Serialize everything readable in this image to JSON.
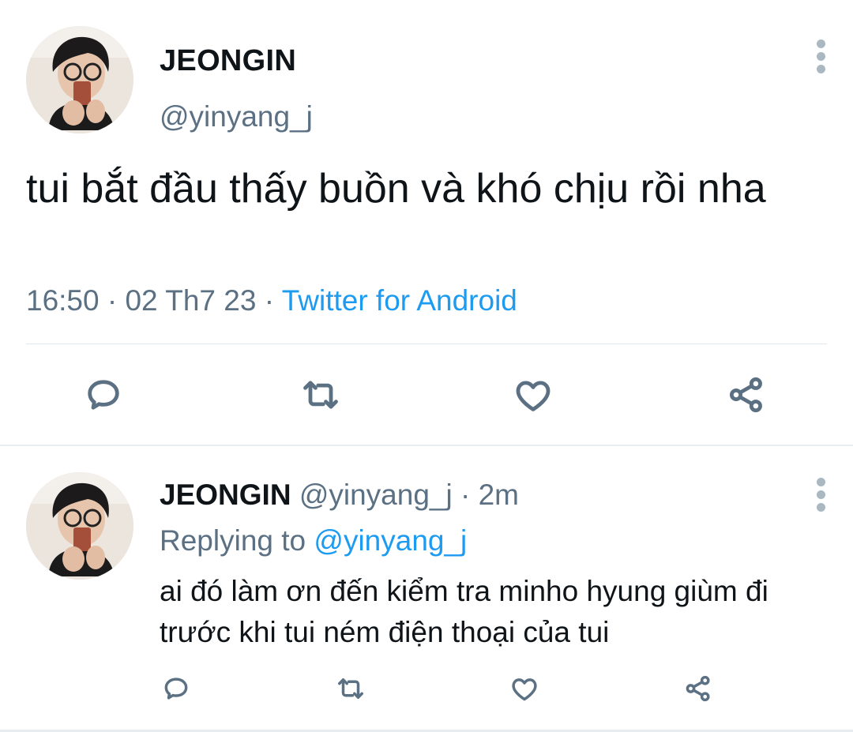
{
  "main_tweet": {
    "name": "JEONGIN",
    "handle": "@yinyang_j",
    "text": "tui bắt đầu thấy buồn và khó chịu rồi nha",
    "time": "16:50",
    "date": "02 Th7 23",
    "source": "Twitter for Android",
    "separator": "·",
    "actions": [
      "reply-icon",
      "retweet-icon",
      "like-icon",
      "share-icon"
    ]
  },
  "reply_tweet": {
    "name": "JEONGIN",
    "handle": "@yinyang_j",
    "dot": "·",
    "time": "2m",
    "replying_label": "Replying to",
    "replying_to": "@yinyang_j",
    "text": "ai đó làm ơn đến kiểm tra minho hyung giùm đi trước khi tui ném điện thoại của tui",
    "actions": [
      "reply-icon",
      "retweet-icon",
      "like-icon",
      "share-icon"
    ]
  },
  "colors": {
    "text": "#0f1419",
    "secondary": "#5b7083",
    "link": "#1d9bf0",
    "divider": "#e1e8ed"
  }
}
